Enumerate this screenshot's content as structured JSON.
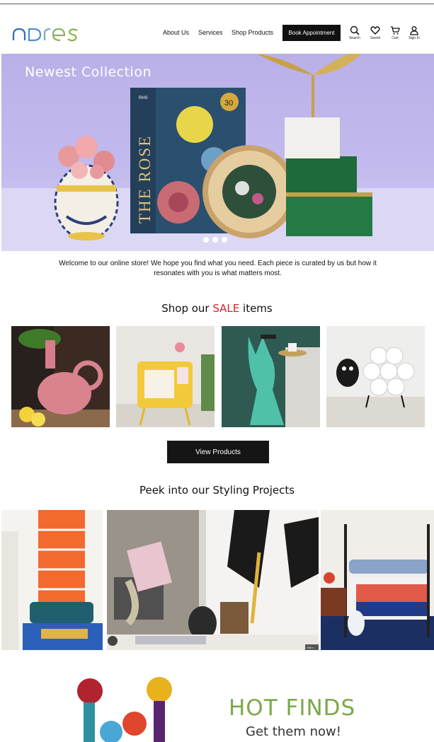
{
  "header": {
    "logo_text": "ndres",
    "nav": [
      "About Us",
      "Services",
      "Shop Products"
    ],
    "book_button": "Book Appointment",
    "icons": [
      {
        "name": "search-icon",
        "label": "Search"
      },
      {
        "name": "heart-icon",
        "label": "Saved"
      },
      {
        "name": "cart-icon",
        "label": "Cart"
      },
      {
        "name": "user-icon",
        "label": "Sign In"
      }
    ]
  },
  "hero": {
    "title": "Newest Collection",
    "book_title": "THE ROSE",
    "book_badge": "30",
    "book_publisher": "RHS",
    "slide_count": 3
  },
  "welcome_text": "Welcome to our online store!  We hope you find what you need.  Each piece is curated by us but how it resonates with you is what matters most.",
  "sale": {
    "heading_prefix": "Shop our ",
    "heading_highlight": "SALE",
    "heading_suffix": " items",
    "items": [
      "sale-item-pink-monkey-planter",
      "sale-item-yellow-tv-shelf",
      "sale-item-teal-dog-sculpture",
      "sale-item-sheep-toilet-roll-holder"
    ],
    "button": "View Products"
  },
  "styling": {
    "heading": "Peek into our Styling Projects",
    "projects": [
      "project-orange-shelf-bedroom",
      "project-still-life-art",
      "project-blue-red-bedroom"
    ],
    "image_badge": "768 ×"
  },
  "hot_finds": {
    "title": "HOT FINDS",
    "subtitle": "Get them now!"
  },
  "colors": {
    "accent_green": "#7ca84a",
    "sale_red": "#d6242c",
    "logo_blue": "#2e6fb0",
    "hero_bg": "#c3bbee"
  }
}
